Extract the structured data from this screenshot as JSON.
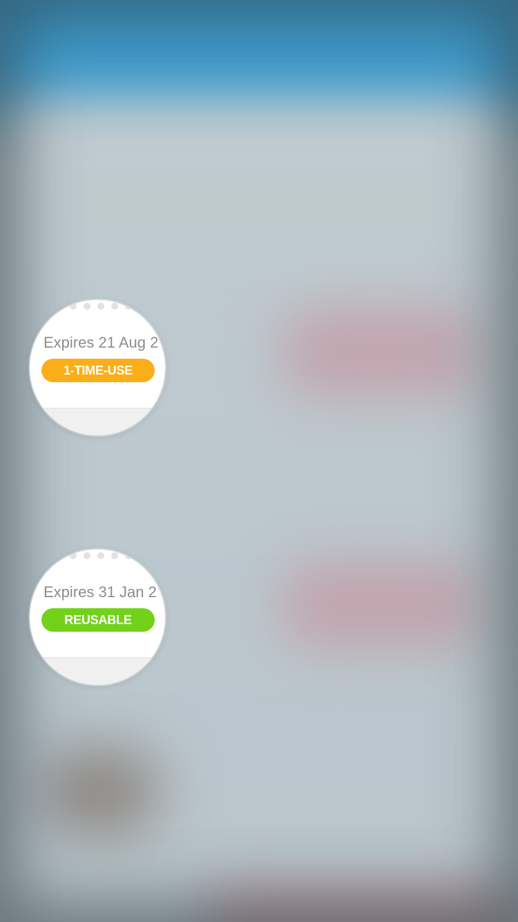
{
  "coupons": [
    {
      "expiry": "Expires 21 Aug 2",
      "tag": "1-TIME-USE",
      "tag_color": "#fbae17"
    },
    {
      "expiry": "Expires 31 Jan 2",
      "tag": "REUSABLE",
      "tag_color": "#72d21a"
    }
  ],
  "colors": {
    "header_blue": "#3f9ccd",
    "background": "#bcc8ce",
    "blurred_accent": "#c2a2ac"
  }
}
